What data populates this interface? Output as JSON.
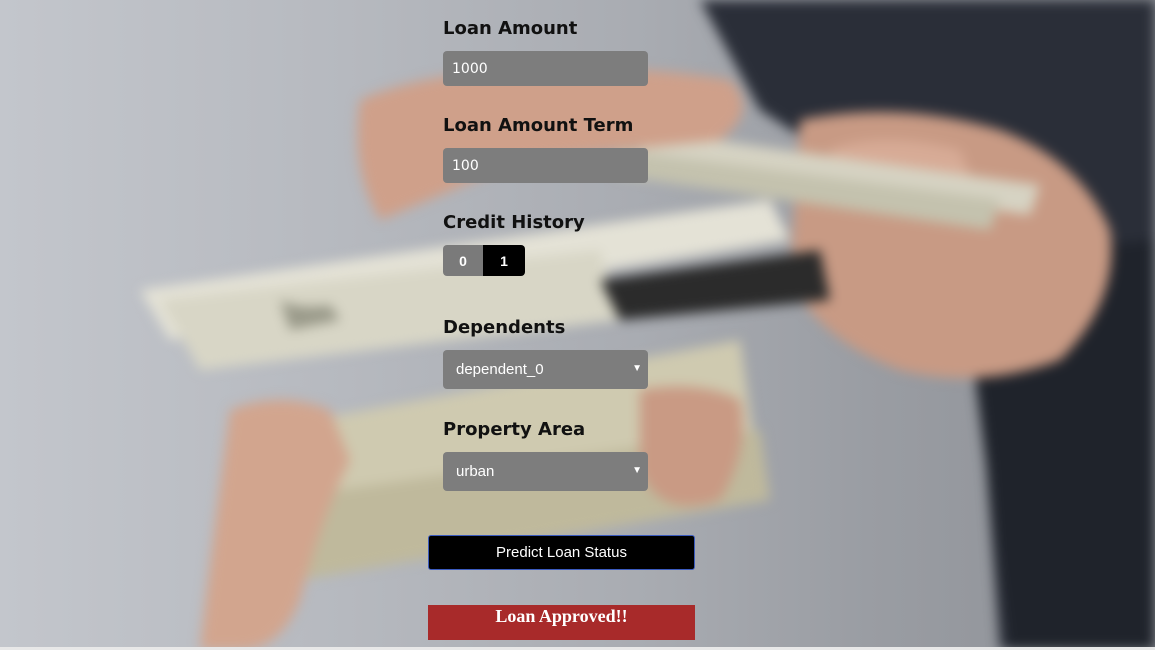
{
  "form": {
    "loan_amount": {
      "label": "Loan Amount",
      "value": "1000"
    },
    "loan_amount_term": {
      "label": "Loan Amount Term",
      "value": "100"
    },
    "credit_history": {
      "label": "Credit History",
      "options": [
        "0",
        "1"
      ],
      "selected": "1"
    },
    "dependents": {
      "label": "Dependents",
      "selected": "dependent_0"
    },
    "property_area": {
      "label": "Property Area",
      "selected": "urban"
    }
  },
  "actions": {
    "predict_label": "Predict Loan Status"
  },
  "result": {
    "text": "Loan Approved!!",
    "color": "#a82a2a"
  },
  "icons": {
    "dropdown_caret": "caret-down-icon"
  }
}
